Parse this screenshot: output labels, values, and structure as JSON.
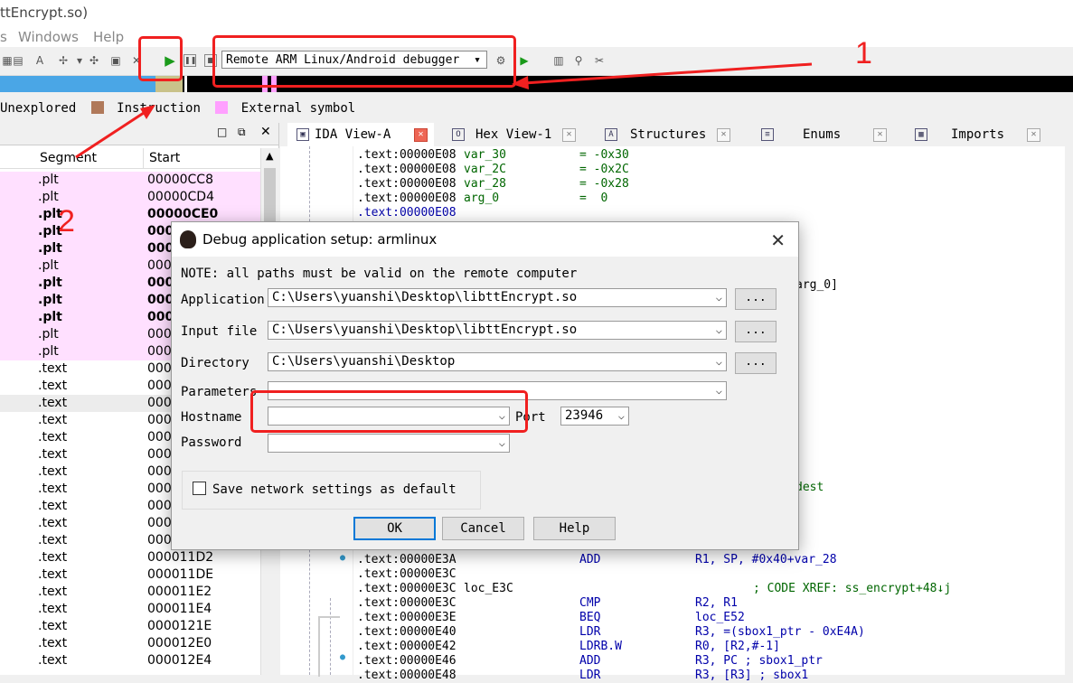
{
  "window": {
    "title": "ttEncrypt.so)"
  },
  "menu": {
    "items": [
      "s",
      "Windows",
      "Help"
    ]
  },
  "toolbar": {
    "debugger": "Remote ARM Linux/Android debugger"
  },
  "legend": {
    "items": [
      "Unexplored",
      "Instruction",
      "External symbol"
    ],
    "colors": [
      "#b0795a",
      "#b0795a",
      "#ffa0ff"
    ]
  },
  "segments": {
    "columns": [
      "Segment",
      "Start"
    ],
    "rows": [
      {
        "seg": ".plt",
        "start": "00000CC8"
      },
      {
        "seg": ".plt",
        "start": "00000CD4"
      },
      {
        "seg": ".plt",
        "start": "00000CE0"
      },
      {
        "seg": ".plt",
        "start": "000"
      },
      {
        "seg": ".plt",
        "start": "000"
      },
      {
        "seg": ".plt",
        "start": "000"
      },
      {
        "seg": ".plt",
        "start": "000"
      },
      {
        "seg": ".plt",
        "start": "000"
      },
      {
        "seg": ".plt",
        "start": "000"
      },
      {
        "seg": ".plt",
        "start": "000"
      },
      {
        "seg": ".plt",
        "start": "000"
      },
      {
        "seg": ".text",
        "start": "000"
      },
      {
        "seg": ".text",
        "start": "000"
      },
      {
        "seg": ".text",
        "start": "000"
      },
      {
        "seg": ".text",
        "start": "000"
      },
      {
        "seg": ".text",
        "start": "000"
      },
      {
        "seg": ".text",
        "start": "000"
      },
      {
        "seg": ".text",
        "start": "000"
      },
      {
        "seg": ".text",
        "start": "000"
      },
      {
        "seg": ".text",
        "start": "000"
      },
      {
        "seg": ".text",
        "start": "000"
      },
      {
        "seg": ".text",
        "start": "000"
      },
      {
        "seg": ".text",
        "start": "000011D2"
      },
      {
        "seg": ".text",
        "start": "000011DE"
      },
      {
        "seg": ".text",
        "start": "000011E2"
      },
      {
        "seg": ".text",
        "start": "000011E4"
      },
      {
        "seg": ".text",
        "start": "0000121E"
      },
      {
        "seg": ".text",
        "start": "000012E0"
      },
      {
        "seg": ".text",
        "start": "000012E4"
      }
    ]
  },
  "tabs": [
    {
      "label": "IDA View-A",
      "icon": "IDA"
    },
    {
      "label": "Hex View-1",
      "icon": "O"
    },
    {
      "label": "Structures",
      "icon": "A"
    },
    {
      "label": "Enums",
      "icon": "≡"
    },
    {
      "label": "Imports",
      "icon": "▦"
    }
  ],
  "disasm": {
    "top": [
      {
        "addr": ".text:00000E08",
        "name": "var_30",
        "eq": "= -0x30"
      },
      {
        "addr": ".text:00000E08",
        "name": "var_2C",
        "eq": "= -0x2C"
      },
      {
        "addr": ".text:00000E08",
        "name": "var_28",
        "eq": "= -0x28"
      },
      {
        "addr": ".text:00000E08",
        "name": "arg_0",
        "eq": "=  0"
      },
      {
        "addr": ".text:00000E08",
        "name": "",
        "eq": ""
      }
    ],
    "peek": [
      "arg_0]",
      "dest"
    ],
    "bottom": [
      {
        "addr": ".text:00000E3A",
        "lbl": "",
        "op": "ADD",
        "args": "R1, SP, #0x40+var_28",
        "cmt": ""
      },
      {
        "addr": ".text:00000E3C",
        "lbl": "",
        "op": "",
        "args": "",
        "cmt": ""
      },
      {
        "addr": ".text:00000E3C",
        "lbl": "loc_E3C",
        "op": "",
        "args": "",
        "cmt": "; CODE XREF: ss_encrypt+48↓j"
      },
      {
        "addr": ".text:00000E3C",
        "lbl": "",
        "op": "CMP",
        "args": "R2, R1",
        "cmt": ""
      },
      {
        "addr": ".text:00000E3E",
        "lbl": "",
        "op": "BEQ",
        "args": "loc_E52",
        "cmt": ""
      },
      {
        "addr": ".text:00000E40",
        "lbl": "",
        "op": "LDR",
        "args": "R3, =(sbox1_ptr - 0xE4A)",
        "cmt": ""
      },
      {
        "addr": ".text:00000E42",
        "lbl": "",
        "op": "LDRB.W",
        "args": "R0, [R2,#-1]",
        "cmt": ""
      },
      {
        "addr": ".text:00000E46",
        "lbl": "",
        "op": "ADD",
        "args": "R3, PC ; sbox1_ptr",
        "cmt": ""
      },
      {
        "addr": ".text:00000E48",
        "lbl": "",
        "op": "LDR",
        "args": "R3, [R3] ; sbox1",
        "cmt": ""
      }
    ]
  },
  "dialog": {
    "title": "Debug application setup: armlinux",
    "note": "NOTE: all paths must be valid on the remote computer",
    "application_label": "Application",
    "application": "C:\\Users\\yuanshi\\Desktop\\libttEncrypt.so",
    "input_label": "Input file",
    "input": "C:\\Users\\yuanshi\\Desktop\\libttEncrypt.so",
    "directory_label": "Directory",
    "directory": "C:\\Users\\yuanshi\\Desktop",
    "parameters_label": "Parameters",
    "parameters": "",
    "hostname_label": "Hostname",
    "hostname": "",
    "port_label": "Port",
    "port": "23946",
    "password_label": "Password",
    "password": "",
    "save_label": "Save network settings as default",
    "browse": "...",
    "ok": "OK",
    "cancel": "Cancel",
    "help": "Help"
  },
  "annotations": {
    "one": "1",
    "two": "2"
  }
}
